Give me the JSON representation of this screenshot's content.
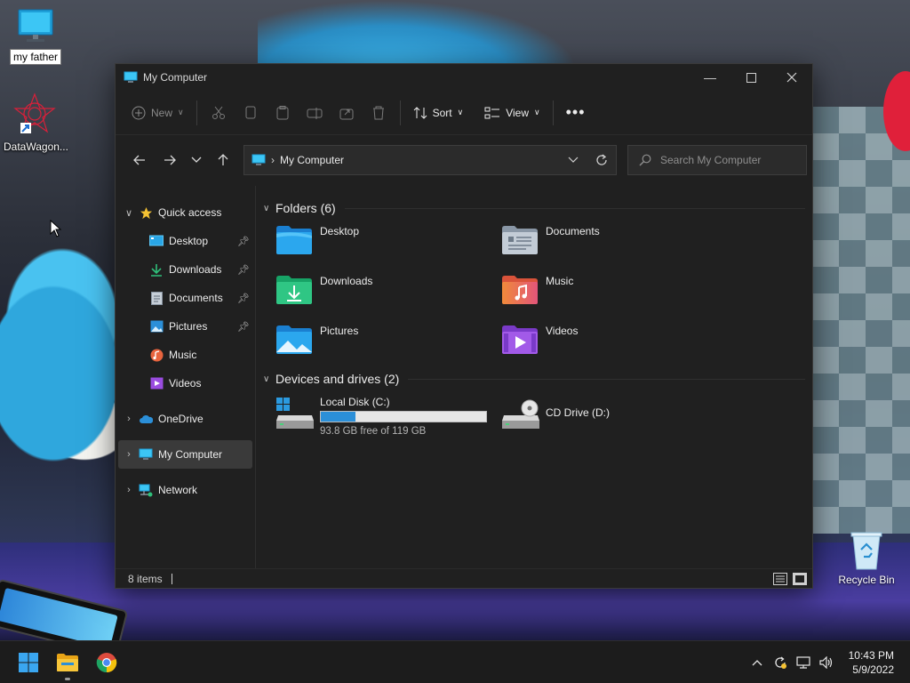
{
  "desktop": {
    "icons": [
      {
        "label": "my father"
      },
      {
        "label": "DataWagon..."
      }
    ],
    "recycle_bin_label": "Recycle Bin"
  },
  "window": {
    "title": "My Computer",
    "toolbar": {
      "new_label": "New",
      "sort_label": "Sort",
      "view_label": "View"
    },
    "address": {
      "crumb": "My Computer",
      "search_placeholder": "Search My Computer"
    },
    "sidebar": {
      "quick_access": "Quick access",
      "items": [
        {
          "label": "Desktop",
          "pinned": true
        },
        {
          "label": "Downloads",
          "pinned": true
        },
        {
          "label": "Documents",
          "pinned": true
        },
        {
          "label": "Pictures",
          "pinned": true
        },
        {
          "label": "Music",
          "pinned": false
        },
        {
          "label": "Videos",
          "pinned": false
        }
      ],
      "onedrive": "OneDrive",
      "my_computer": "My Computer",
      "network": "Network"
    },
    "folders_header": "Folders (6)",
    "folders": [
      {
        "name": "Desktop",
        "icon": "desktop-folder-icon"
      },
      {
        "name": "Documents",
        "icon": "documents-folder-icon"
      },
      {
        "name": "Downloads",
        "icon": "downloads-folder-icon"
      },
      {
        "name": "Music",
        "icon": "music-folder-icon"
      },
      {
        "name": "Pictures",
        "icon": "pictures-folder-icon"
      },
      {
        "name": "Videos",
        "icon": "videos-folder-icon"
      }
    ],
    "drives_header": "Devices and drives (2)",
    "drives": [
      {
        "name": "Local Disk (C:)",
        "free_text": "93.8 GB free of 119 GB",
        "used_fraction": 0.21
      },
      {
        "name": "CD Drive (D:)"
      }
    ],
    "status": {
      "item_count": "8 items"
    }
  },
  "taskbar": {
    "clock_time": "10:43 PM",
    "clock_date": "5/9/2022"
  },
  "colors": {
    "accent": "#2b8fd8",
    "window_bg": "#202020",
    "taskbar_bg": "#1c1c1c"
  }
}
